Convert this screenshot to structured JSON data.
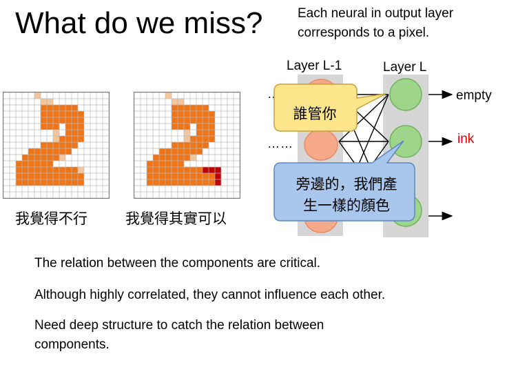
{
  "slide": {
    "title": "What do we miss?",
    "note_line1": "Each neural in output layer",
    "note_line2": "corresponds to a pixel."
  },
  "images": [
    {
      "caption": "我覺得不行"
    },
    {
      "caption": "我覺得其實可以"
    }
  ],
  "diagram": {
    "layer_prev_label": "Layer L-1",
    "layer_label": "Layer L",
    "dots_top": "……",
    "dots_mid": "……",
    "outputs": [
      {
        "label": "empty",
        "color": "#000000"
      },
      {
        "label": "ink",
        "color": "#e00000"
      },
      {
        "label": "",
        "color": "#000000"
      }
    ],
    "callout_top": "誰管你",
    "callout_bottom_line1": "旁邊的，我們產",
    "callout_bottom_line2": "生一樣的顏色"
  },
  "points": [
    "The relation between the components are critical.",
    "Although highly correlated, they cannot influence each other.",
    "Need deep structure to catch the relation between",
    "components."
  ],
  "colors": {
    "orange_pixel": "#ee7418",
    "light_pixel": "#f3c59a",
    "red_pixel": "#c00000",
    "neuron_green": "#9fd58a",
    "neuron_orange": "#f5a989",
    "yellow_callout": "#fce58a",
    "blue_callout": "#a9c6ec"
  }
}
